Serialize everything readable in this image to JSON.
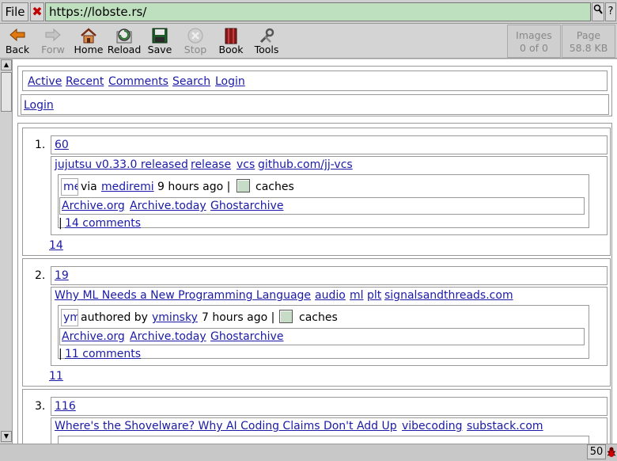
{
  "urlbar": {
    "file_label": "File",
    "close_glyph": "✖",
    "url": "https://lobste.rs/",
    "search_glyph": "🔍",
    "help_glyph": "?"
  },
  "toolbar": {
    "buttons": [
      {
        "label": "Back",
        "icon": "back-arrow-icon"
      },
      {
        "label": "Forw",
        "icon": "forward-arrow-icon"
      },
      {
        "label": "Home",
        "icon": "home-icon"
      },
      {
        "label": "Reload",
        "icon": "reload-icon"
      },
      {
        "label": "Save",
        "icon": "save-icon"
      },
      {
        "label": "Stop",
        "icon": "stop-icon"
      },
      {
        "label": "Book",
        "icon": "bookmark-icon"
      },
      {
        "label": "Tools",
        "icon": "tools-icon"
      }
    ],
    "images_label": "Images",
    "images_value": "0 of 0",
    "page_label": "Page",
    "page_value": "58.8 KB"
  },
  "nav": {
    "links": [
      "Active",
      "Recent",
      "Comments",
      "Search",
      "Login"
    ],
    "login": "Login"
  },
  "stories": [
    {
      "rank": "1.",
      "score": "60",
      "title": "jujutsu v0.33.0 released",
      "tags": [
        "release",
        "vcs"
      ],
      "domain": "github.com/jj-vcs",
      "avatar_text": "me",
      "byline_prefix": "via",
      "user": "mediremi",
      "time": "9 hours ago |",
      "caches_label": "caches",
      "archives": [
        "Archive.org",
        "Archive.today",
        "Ghostarchive"
      ],
      "comments_sep": "|",
      "comments": "14 comments",
      "comment_count": "14"
    },
    {
      "rank": "2.",
      "score": "19",
      "title": "Why ML Needs a New Programming Language",
      "tags": [
        "audio",
        "ml",
        "plt"
      ],
      "domain": "signalsandthreads.com",
      "avatar_text": "ym",
      "byline_prefix": "authored by",
      "user": "yminsky",
      "time": "7 hours ago |",
      "caches_label": "caches",
      "archives": [
        "Archive.org",
        "Archive.today",
        "Ghostarchive"
      ],
      "comments_sep": "|",
      "comments": "11 comments",
      "comment_count": "11"
    },
    {
      "rank": "3.",
      "score": "116",
      "title": "Where's the Shovelware? Why AI Coding Claims Don't Add Up",
      "tags": [
        "vibecoding"
      ],
      "domain": "substack.com"
    }
  ],
  "status": {
    "message": "",
    "count": "50"
  }
}
